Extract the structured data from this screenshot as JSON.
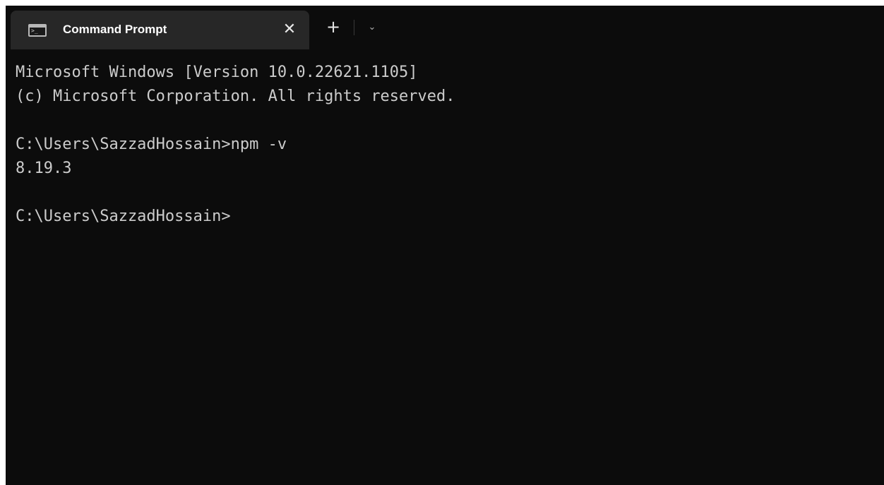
{
  "tab": {
    "title": "Command Prompt",
    "icon": "console-icon",
    "close_glyph": "✕"
  },
  "toolbar": {
    "new_tab_glyph": "+",
    "dropdown_glyph": "⌄"
  },
  "terminal": {
    "lines": [
      "Microsoft Windows [Version 10.0.22621.1105]",
      "(c) Microsoft Corporation. All rights reserved.",
      "",
      "C:\\Users\\SazzadHossain>npm -v",
      "8.19.3",
      "",
      "C:\\Users\\SazzadHossain>"
    ]
  },
  "colors": {
    "background": "#0c0c0c",
    "tab_background": "#272727",
    "text": "#cccccc"
  }
}
